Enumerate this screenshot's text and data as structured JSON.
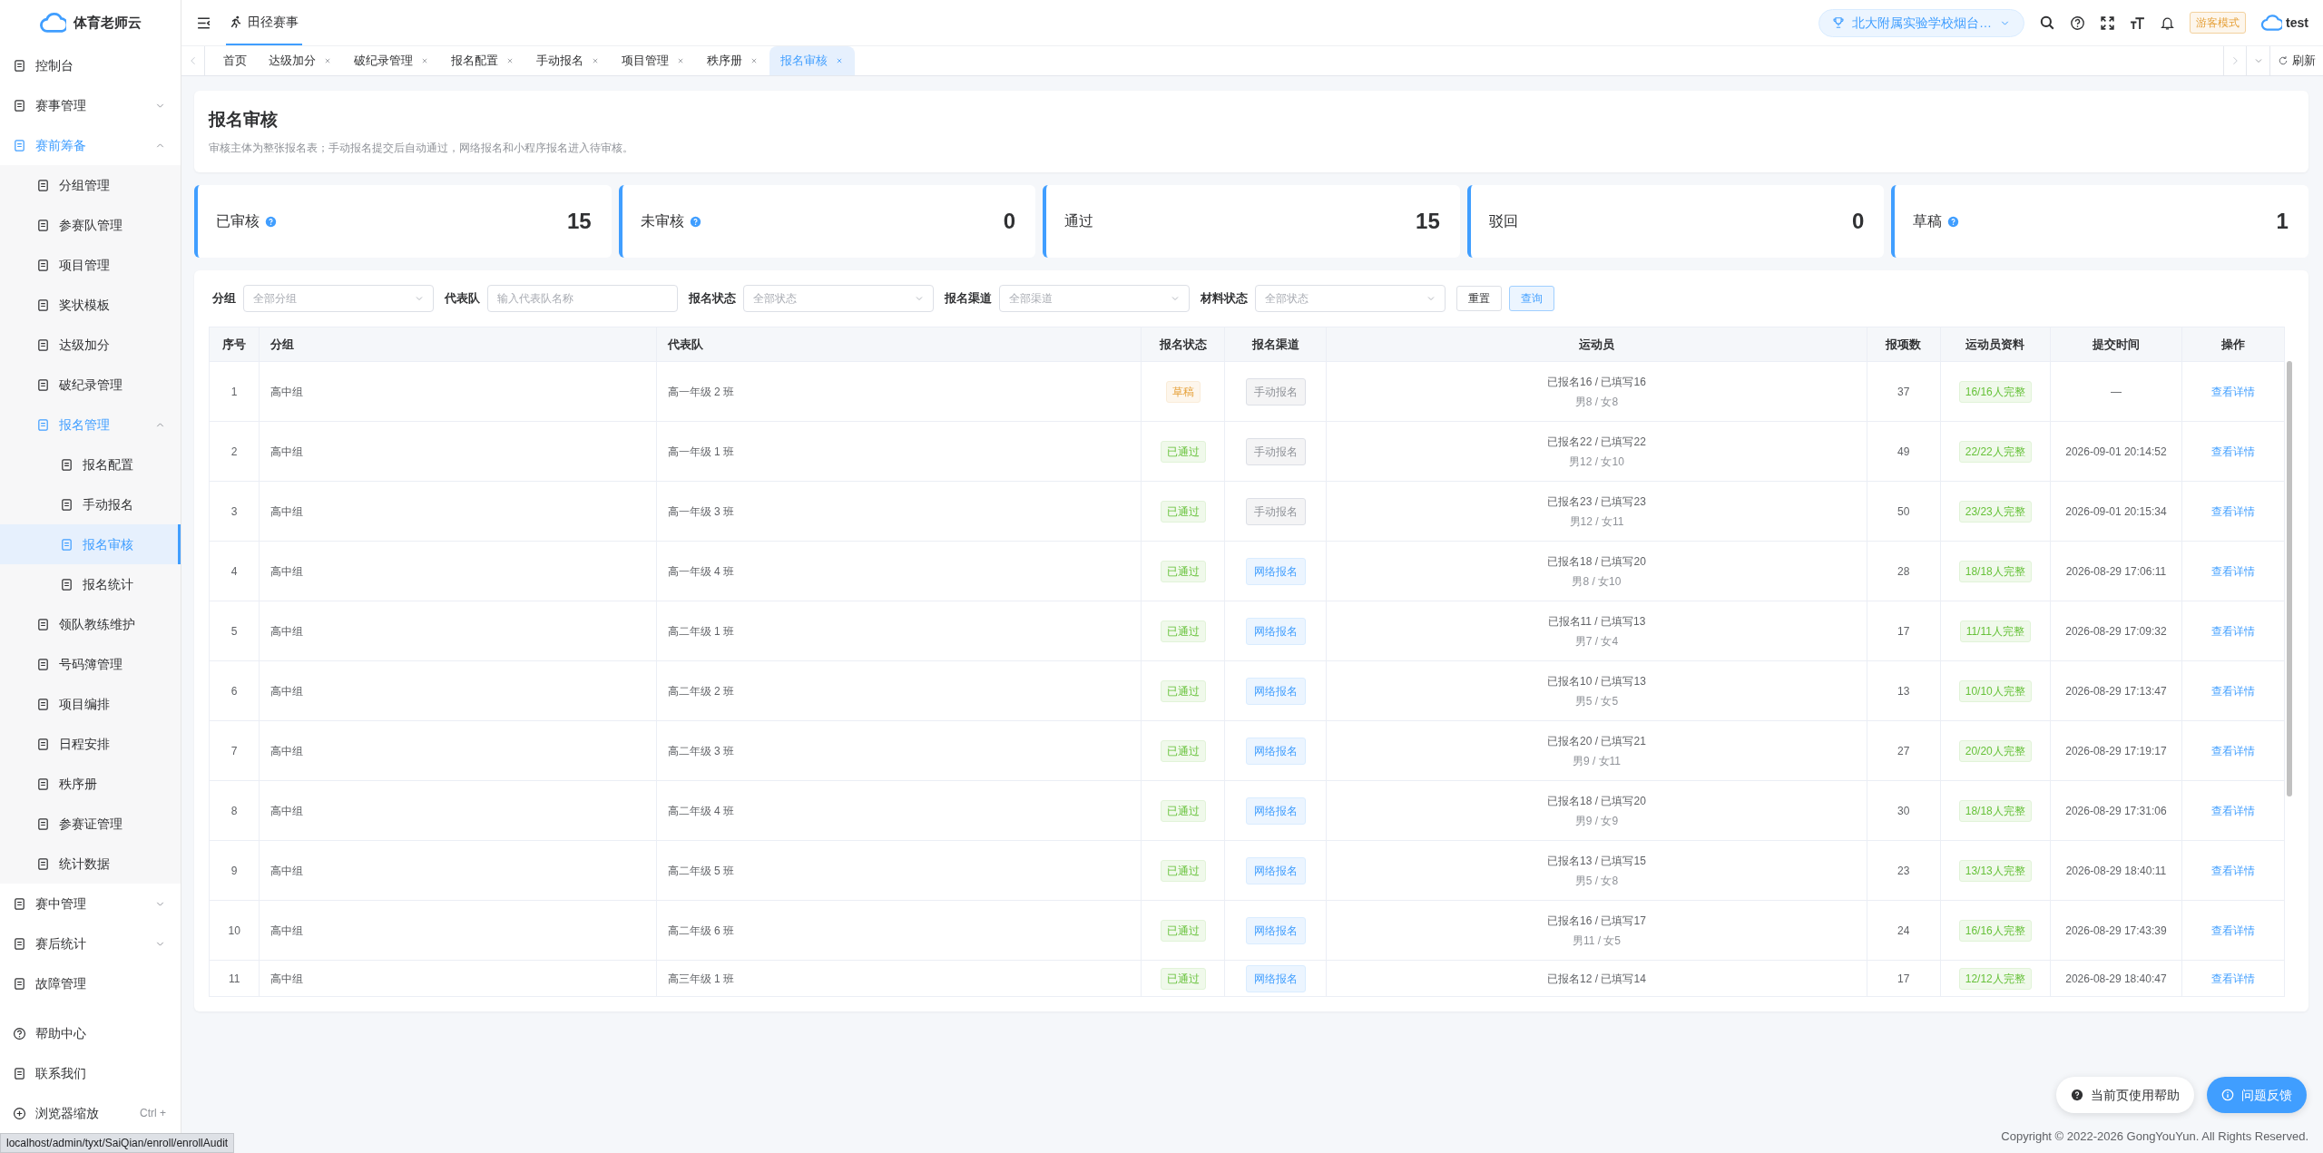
{
  "sidebar": {
    "logo_text": "体育老师云",
    "items": [
      {
        "label": "控制台",
        "selected": false
      },
      {
        "label": "赛事管理",
        "selected": false,
        "expanded": false
      },
      {
        "label": "赛前筹备",
        "selected": false,
        "expanded": true,
        "children": [
          {
            "label": "分组管理",
            "selected": false
          },
          {
            "label": "参赛队管理",
            "selected": false
          },
          {
            "label": "项目管理",
            "selected": false
          },
          {
            "label": "奖状模板",
            "selected": false
          },
          {
            "label": "达级加分",
            "selected": false
          },
          {
            "label": "破纪录管理",
            "selected": false
          },
          {
            "label": "报名管理",
            "selected": false,
            "expanded": true,
            "children": [
              {
                "label": "报名配置",
                "selected": false
              },
              {
                "label": "手动报名",
                "selected": false
              },
              {
                "label": "报名审核",
                "selected": true
              },
              {
                "label": "报名统计",
                "selected": false
              }
            ]
          },
          {
            "label": "领队教练维护",
            "selected": false
          },
          {
            "label": "号码簿管理",
            "selected": false
          },
          {
            "label": "项目编排",
            "selected": false
          },
          {
            "label": "日程安排",
            "selected": false
          },
          {
            "label": "秩序册",
            "selected": false
          },
          {
            "label": "参赛证管理",
            "selected": false
          },
          {
            "label": "统计数据",
            "selected": false
          }
        ]
      },
      {
        "label": "赛中管理",
        "selected": false,
        "expanded": false
      },
      {
        "label": "赛后统计",
        "selected": false,
        "expanded": false
      },
      {
        "label": "故障管理",
        "selected": false
      }
    ],
    "bottom_items": [
      {
        "label": "帮助中心"
      },
      {
        "label": "联系我们"
      },
      {
        "label": "浏览器缩放",
        "shortcut": "Ctrl +"
      }
    ]
  },
  "header": {
    "module_tab": {
      "label": "田径赛事",
      "selected": true
    },
    "school": "北大附属实验学校烟台…",
    "mode_badge": "游客模式",
    "user": "test"
  },
  "tabs": [
    {
      "label": "首页",
      "selected": false,
      "closable": false
    },
    {
      "label": "达级加分",
      "selected": false,
      "closable": true
    },
    {
      "label": "破纪录管理",
      "selected": false,
      "closable": true
    },
    {
      "label": "报名配置",
      "selected": false,
      "closable": true
    },
    {
      "label": "手动报名",
      "selected": false,
      "closable": true
    },
    {
      "label": "项目管理",
      "selected": false,
      "closable": true
    },
    {
      "label": "秩序册",
      "selected": false,
      "closable": true
    },
    {
      "label": "报名审核",
      "selected": true,
      "closable": true
    }
  ],
  "refresh_label": "刷新",
  "page": {
    "title": "报名审核",
    "description": "审核主体为整张报名表；手动报名提交后自动通过，网络报名和小程序报名进入待审核。"
  },
  "stats": [
    {
      "label": "已审核",
      "value": "15",
      "help": true
    },
    {
      "label": "未审核",
      "value": "0",
      "help": true
    },
    {
      "label": "通过",
      "value": "15",
      "help": false
    },
    {
      "label": "驳回",
      "value": "0",
      "help": false
    },
    {
      "label": "草稿",
      "value": "1",
      "help": true
    }
  ],
  "filters": [
    {
      "label": "分组",
      "kind": "select",
      "placeholder": "全部分组"
    },
    {
      "label": "代表队",
      "kind": "input",
      "placeholder": "输入代表队名称"
    },
    {
      "label": "报名状态",
      "kind": "select",
      "placeholder": "全部状态"
    },
    {
      "label": "报名渠道",
      "kind": "select",
      "placeholder": "全部渠道"
    },
    {
      "label": "材料状态",
      "kind": "select",
      "placeholder": "全部状态"
    }
  ],
  "filter_buttons": [
    {
      "label": "重置",
      "kind": "default"
    },
    {
      "label": "查询",
      "kind": "primary"
    }
  ],
  "table": {
    "columns": [
      "序号",
      "分组",
      "代表队",
      "报名状态",
      "报名渠道",
      "运动员",
      "报项数",
      "运动员资料",
      "提交时间",
      "操作"
    ],
    "rows": [
      {
        "no": "1",
        "group": "高中组",
        "team": "高一年级 2 班",
        "status": {
          "text": "草稿",
          "kind": "draft"
        },
        "channel": {
          "text": "手动报名",
          "kind": "manual"
        },
        "athletes": "已报名16 / 已填写16",
        "gender": "男8 / 女8",
        "count": "37",
        "material": "16/16人完整",
        "time": "—",
        "action": "查看详情"
      },
      {
        "no": "2",
        "group": "高中组",
        "team": "高一年级 1 班",
        "status": {
          "text": "已通过",
          "kind": "passed"
        },
        "channel": {
          "text": "手动报名",
          "kind": "manual"
        },
        "athletes": "已报名22 / 已填写22",
        "gender": "男12 / 女10",
        "count": "49",
        "material": "22/22人完整",
        "time": "2026-09-01 20:14:52",
        "action": "查看详情"
      },
      {
        "no": "3",
        "group": "高中组",
        "team": "高一年级 3 班",
        "status": {
          "text": "已通过",
          "kind": "passed"
        },
        "channel": {
          "text": "手动报名",
          "kind": "manual"
        },
        "athletes": "已报名23 / 已填写23",
        "gender": "男12 / 女11",
        "count": "50",
        "material": "23/23人完整",
        "time": "2026-09-01 20:15:34",
        "action": "查看详情"
      },
      {
        "no": "4",
        "group": "高中组",
        "team": "高一年级 4 班",
        "status": {
          "text": "已通过",
          "kind": "passed"
        },
        "channel": {
          "text": "网络报名",
          "kind": "online"
        },
        "athletes": "已报名18 / 已填写20",
        "gender": "男8 / 女10",
        "count": "28",
        "material": "18/18人完整",
        "time": "2026-08-29 17:06:11",
        "action": "查看详情"
      },
      {
        "no": "5",
        "group": "高中组",
        "team": "高二年级 1 班",
        "status": {
          "text": "已通过",
          "kind": "passed"
        },
        "channel": {
          "text": "网络报名",
          "kind": "online"
        },
        "athletes": "已报名11 / 已填写13",
        "gender": "男7 / 女4",
        "count": "17",
        "material": "11/11人完整",
        "time": "2026-08-29 17:09:32",
        "action": "查看详情"
      },
      {
        "no": "6",
        "group": "高中组",
        "team": "高二年级 2 班",
        "status": {
          "text": "已通过",
          "kind": "passed"
        },
        "channel": {
          "text": "网络报名",
          "kind": "online"
        },
        "athletes": "已报名10 / 已填写13",
        "gender": "男5 / 女5",
        "count": "13",
        "material": "10/10人完整",
        "time": "2026-08-29 17:13:47",
        "action": "查看详情"
      },
      {
        "no": "7",
        "group": "高中组",
        "team": "高二年级 3 班",
        "status": {
          "text": "已通过",
          "kind": "passed"
        },
        "channel": {
          "text": "网络报名",
          "kind": "online"
        },
        "athletes": "已报名20 / 已填写21",
        "gender": "男9 / 女11",
        "count": "27",
        "material": "20/20人完整",
        "time": "2026-08-29 17:19:17",
        "action": "查看详情"
      },
      {
        "no": "8",
        "group": "高中组",
        "team": "高二年级 4 班",
        "status": {
          "text": "已通过",
          "kind": "passed"
        },
        "channel": {
          "text": "网络报名",
          "kind": "online"
        },
        "athletes": "已报名18 / 已填写20",
        "gender": "男9 / 女9",
        "count": "30",
        "material": "18/18人完整",
        "time": "2026-08-29 17:31:06",
        "action": "查看详情"
      },
      {
        "no": "9",
        "group": "高中组",
        "team": "高二年级 5 班",
        "status": {
          "text": "已通过",
          "kind": "passed"
        },
        "channel": {
          "text": "网络报名",
          "kind": "online"
        },
        "athletes": "已报名13 / 已填写15",
        "gender": "男5 / 女8",
        "count": "23",
        "material": "13/13人完整",
        "time": "2026-08-29 18:40:11",
        "action": "查看详情"
      },
      {
        "no": "10",
        "group": "高中组",
        "team": "高二年级 6 班",
        "status": {
          "text": "已通过",
          "kind": "passed"
        },
        "channel": {
          "text": "网络报名",
          "kind": "online"
        },
        "athletes": "已报名16 / 已填写17",
        "gender": "男11 / 女5",
        "count": "24",
        "material": "16/16人完整",
        "time": "2026-08-29 17:43:39",
        "action": "查看详情"
      },
      {
        "no": "11",
        "group": "高中组",
        "team": "高三年级 1 班",
        "status": {
          "text": "已通过",
          "kind": "passed"
        },
        "channel": {
          "text": "网络报名",
          "kind": "online"
        },
        "athletes": "已报名12 / 已填写14",
        "count": "17",
        "material": "12/12人完整",
        "time": "2026-08-29 18:40:47",
        "action": "查看详情"
      }
    ]
  },
  "float_buttons": [
    {
      "label": "当前页使用帮助",
      "kind": "default"
    },
    {
      "label": "问题反馈",
      "kind": "primary"
    }
  ],
  "copyright": "Copyright © 2022-2026 GongYouYun. All Rights Reserved.",
  "status_url": "localhost/admin/tyxt/SaiQian/enroll/enrollAudit"
}
